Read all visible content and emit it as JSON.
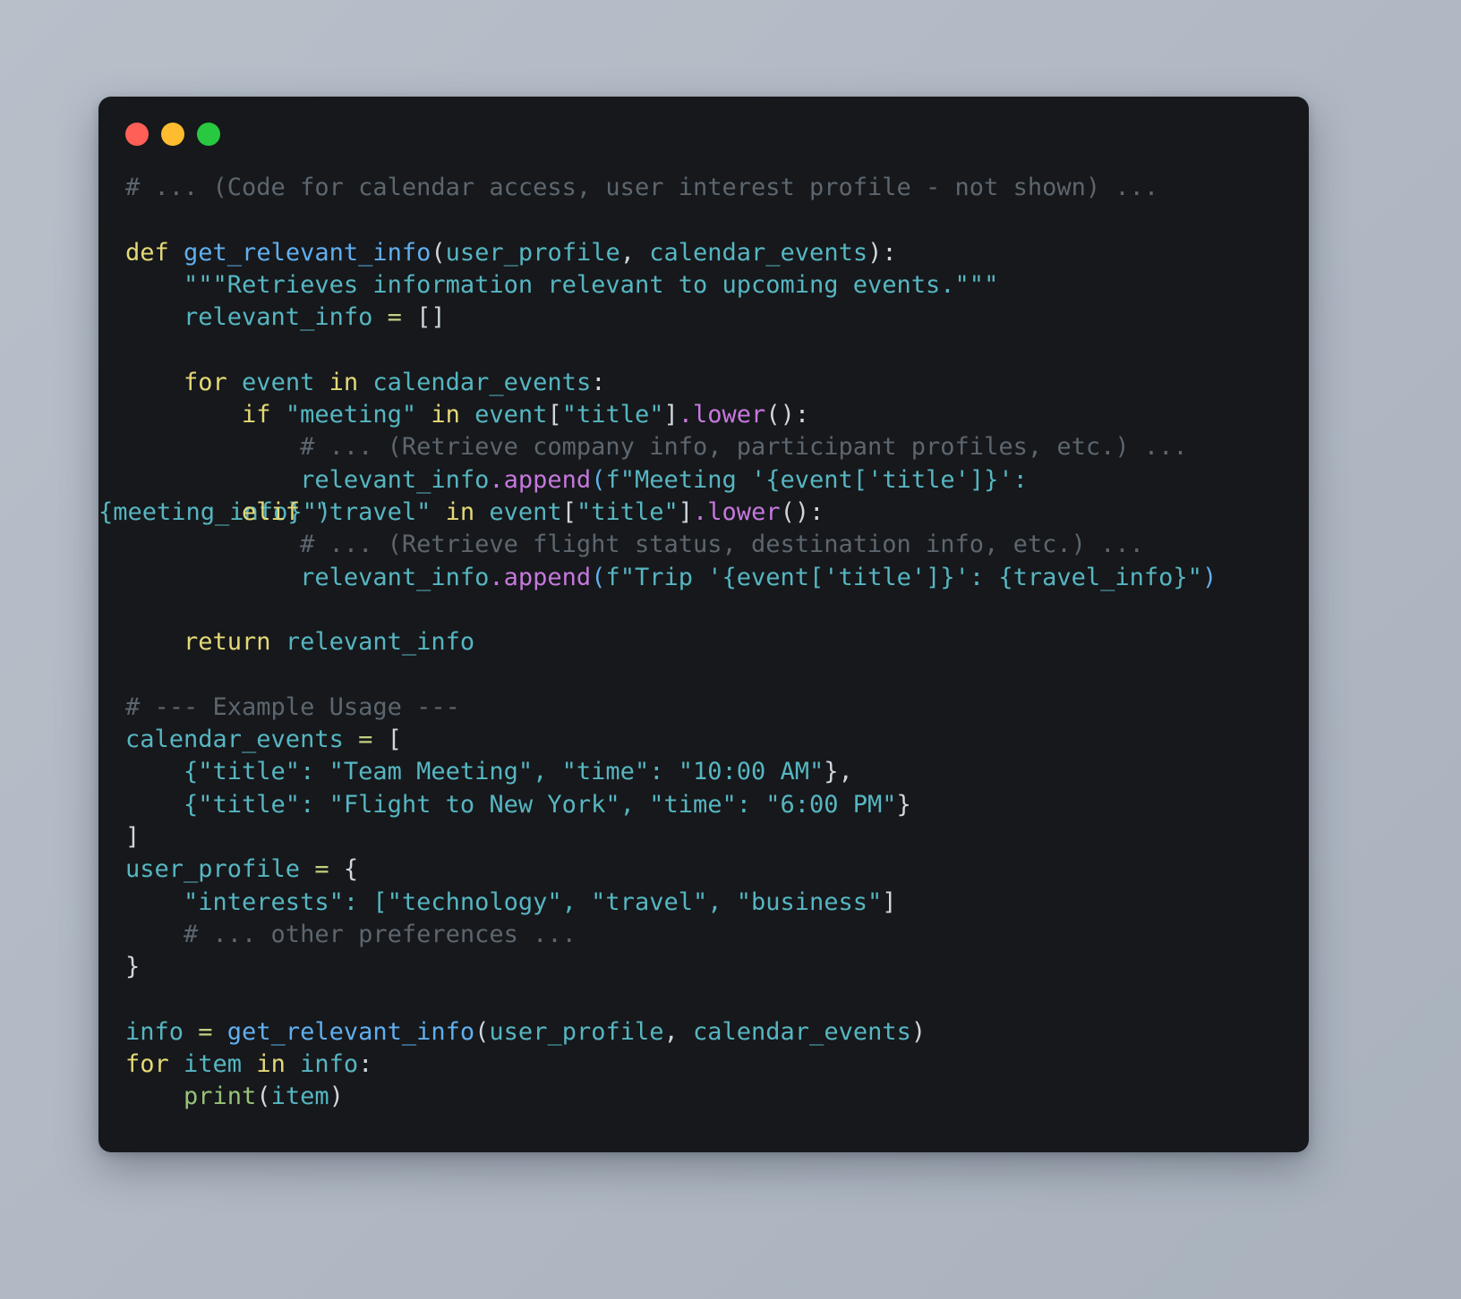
{
  "window": {
    "title_bar": {
      "buttons": [
        {
          "name": "close",
          "color": "#ff5f57"
        },
        {
          "name": "minimize",
          "color": "#febc2e"
        },
        {
          "name": "maximize",
          "color": "#28c840"
        }
      ]
    },
    "background_color": "#16181b",
    "page_background": "#b4bcc6"
  },
  "code": {
    "language": "python",
    "lines": {
      "l1": "# ... (Code for calendar access, user interest profile - not shown) ...",
      "l2": "",
      "l3_def": "def",
      "l3_name": " get_relevant_info",
      "l3_paren_open": "(",
      "l3_arg1": "user_profile",
      "l3_comma": ", ",
      "l3_arg2": "calendar_events",
      "l3_tail": "):",
      "l4": "    \"\"\"Retrieves information relevant to upcoming events.\"\"\"",
      "l5_name": "    relevant_info ",
      "l5_op": "=",
      "l5_val": " []",
      "l6": "",
      "l7_for": "    for",
      "l7_var": " event ",
      "l7_in": "in",
      "l7_iter": " calendar_events",
      "l7_colon": ":",
      "l8_if": "        if",
      "l8_str": " \"meeting\" ",
      "l8_in": "in",
      "l8_obj": " event",
      "l8_b1": "[",
      "l8_key": "\"title\"",
      "l8_b2": "]",
      "l8_dot": ".",
      "l8_m": "lower",
      "l8_call": "():",
      "l9": "            # ... (Retrieve company info, participant profiles, etc.) ...",
      "l10_a": "            relevant_info",
      "l10_dot": ".",
      "l10_m": "append",
      "l10_p": "(",
      "l10_s": "f\"Meeting '{event['title']}':",
      "l11_over_under": "{meeting_info}\")",
      "l11_elif": "        elif",
      "l11_str": " \"travel\" ",
      "l11_in": "in",
      "l11_obj": " event",
      "l11_b1": "[",
      "l11_key": "\"title\"",
      "l11_b2": "]",
      "l11_dot": ".",
      "l11_m": "lower",
      "l11_call": "():",
      "l12": "            # ... (Retrieve flight status, destination info, etc.) ...",
      "l13_a": "            relevant_info",
      "l13_dot": ".",
      "l13_m": "append",
      "l13_p": "(",
      "l13_s": "f\"Trip '{event['title']}': {travel_info}\"",
      "l13_close": ")",
      "l14": "",
      "l15_ret": "    return",
      "l15_val": " relevant_info",
      "l16": "",
      "l17": "# --- Example Usage ---",
      "l18_name": "calendar_events ",
      "l18_op": "=",
      "l18_br": " [",
      "l19_str": "    {\"title\": \"Team Meeting\", \"time\": \"10:00 AM\"",
      "l19_end": "},",
      "l20_str": "    {\"title\": \"Flight to New York\", \"time\": \"6:00 PM\"",
      "l20_end": "}",
      "l21": "]",
      "l22_name": "user_profile ",
      "l22_op": "=",
      "l22_br": " {",
      "l23_str": "    \"interests\": [\"technology\", \"travel\", \"business\"",
      "l23_end": "]",
      "l24": "    # ... other preferences ...",
      "l25": "}",
      "l26": "",
      "l27_name": "info ",
      "l27_op": "=",
      "l27_fn": " get_relevant_info",
      "l27_p": "(",
      "l27_a1": "user_profile",
      "l27_comma": ", ",
      "l27_a2": "calendar_events",
      "l27_close": ")",
      "l28_for": "for",
      "l28_var": " item ",
      "l28_in": "in",
      "l28_iter": " info",
      "l28_colon": ":",
      "l29_ind": "    ",
      "l29_fn": "print",
      "l29_p": "(",
      "l29_arg": "item",
      "l29_close": ")"
    },
    "colors": {
      "comment": "#5d666f",
      "keyword": "#e5d977",
      "identifier": "#56b6c2",
      "function": "#61afef",
      "string": "#56b6c2",
      "method": "#c678dd",
      "operator": "#c3d082",
      "builtin": "#98c379",
      "punctuation": "#cfd6dd"
    }
  }
}
